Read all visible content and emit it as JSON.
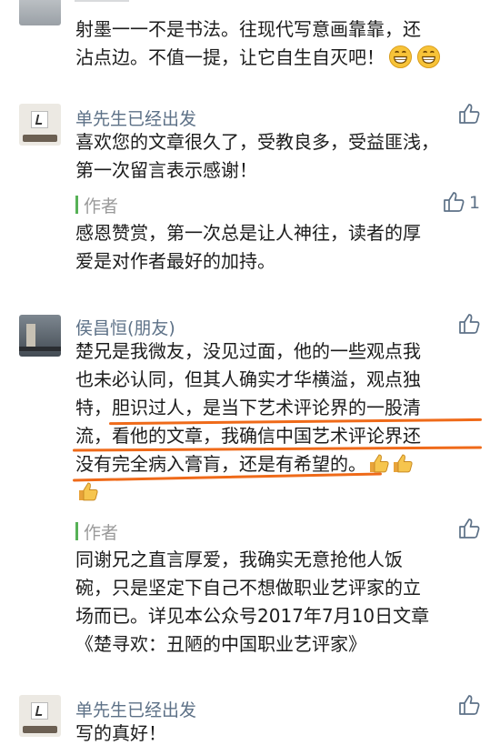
{
  "comments": [
    {
      "lines": [
        "射墨一一不是书法。往现代写意画靠靠，还",
        "沾点边。不值一提，让它自生自灭吧！"
      ],
      "emoji": "grin-emoji"
    },
    {
      "user": "单先生已经出发",
      "lines": [
        "喜欢您的文章很久了，受教良多，受益匪浅，",
        "第一次留言表示感谢！"
      ],
      "reply": {
        "author": "作者",
        "like_count": "1",
        "lines": [
          "感恩赞赏，第一次总是让人神往，读者的厚",
          "爱是对作者最好的加持。"
        ]
      }
    },
    {
      "user": "侯昌恒(朋友)",
      "lines": [
        "楚兄是我微友，没见过面，他的一些观点我",
        "也未必认同，但其人确实才华横溢，观点独",
        "特，胆识过人，是当下艺术评论界的一股清",
        "流，看他的文章，我确信中国艺术评论界还",
        "没有完全病入膏肓，还是有希望的。"
      ],
      "reply": {
        "author": "作者",
        "lines": [
          "同谢兄之直言厚爱，我确实无意抢他人饭",
          "碗，只是坚定下自己不想做职业艺评家的立",
          "场而已。详见本公众号2017年7月10日文章",
          "《楚寻欢：丑陋的中国职业艺评家》"
        ]
      }
    },
    {
      "user": "单先生已经出发",
      "lines": [
        "写的真好！"
      ]
    }
  ],
  "colors": {
    "name": "#5d7187",
    "highlight": "#ef6a19",
    "author_bar": "#57b157"
  }
}
